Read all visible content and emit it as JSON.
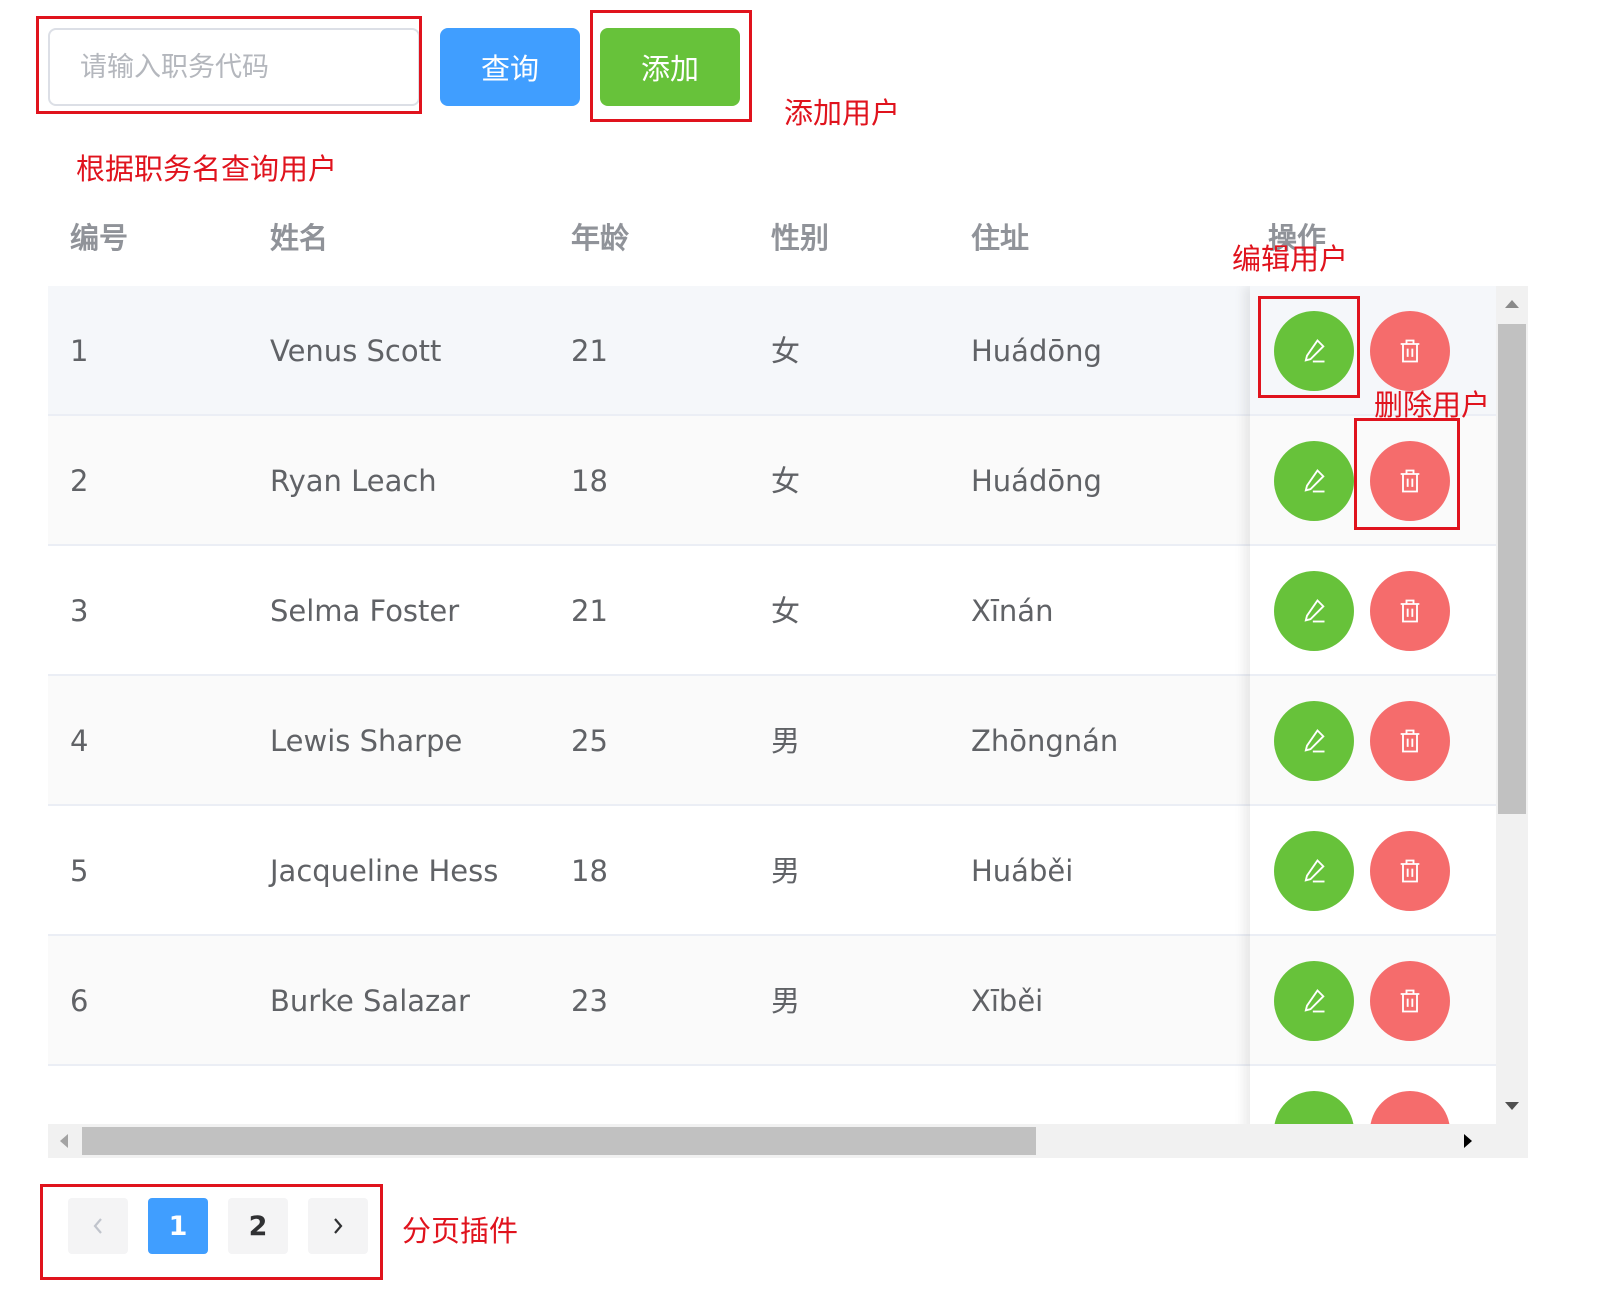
{
  "toolbar": {
    "search_placeholder": "请输入职务代码",
    "query_label": "查询",
    "add_label": "添加"
  },
  "annotations": {
    "add_user": "添加用户",
    "query_by_position": "根据职务名查询用户",
    "edit_user": "编辑用户",
    "delete_user": "删除用户",
    "pagination": "分页插件"
  },
  "table": {
    "headers": [
      "编号",
      "姓名",
      "年龄",
      "性别",
      "住址",
      "操作"
    ],
    "rows": [
      {
        "id": "1",
        "name": "Venus Scott",
        "age": "21",
        "gender": "女",
        "address": "Huádōng"
      },
      {
        "id": "2",
        "name": "Ryan Leach",
        "age": "18",
        "gender": "女",
        "address": "Huádōng"
      },
      {
        "id": "3",
        "name": "Selma Foster",
        "age": "21",
        "gender": "女",
        "address": "Xīnán"
      },
      {
        "id": "4",
        "name": "Lewis Sharpe",
        "age": "25",
        "gender": "男",
        "address": "Zhōngnán"
      },
      {
        "id": "5",
        "name": "Jacqueline Hess",
        "age": "18",
        "gender": "男",
        "address": "Huáběi"
      },
      {
        "id": "6",
        "name": "Burke Salazar",
        "age": "23",
        "gender": "男",
        "address": "Xīběi"
      }
    ],
    "row_actions": {
      "edit_icon": "edit-pencil-icon",
      "delete_icon": "trash-icon"
    }
  },
  "pagination": {
    "prev_icon": "chevron-left-icon",
    "pages": [
      "1",
      "2"
    ],
    "current_page": "1",
    "next_icon": "chevron-right-icon"
  },
  "colors": {
    "primary": "#409eff",
    "success": "#67c23a",
    "danger": "#f56c6c",
    "annotation_red": "#e0131d"
  }
}
